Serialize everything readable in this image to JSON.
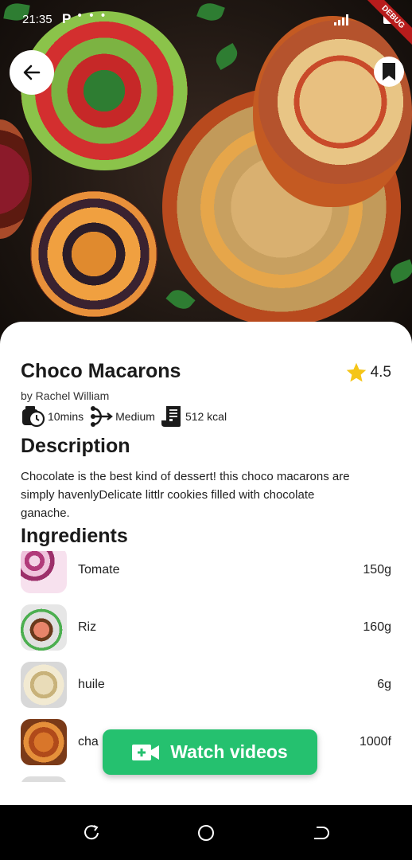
{
  "status_bar": {
    "time": "21:35",
    "notif_glyph": "P",
    "dots": "• • •",
    "debug_banner": "DEBUG"
  },
  "hero": {
    "back_icon": "arrow-left-icon",
    "bookmark_icon": "bookmark-icon"
  },
  "recipe": {
    "title": "Choco Macarons",
    "rating": "4.5",
    "author": "by Rachel William",
    "meta": [
      {
        "icon": "timer-icon",
        "label": "10mins"
      },
      {
        "icon": "difficulty-icon",
        "label": "Medium"
      },
      {
        "icon": "receipt-icon",
        "label": "512 kcal"
      }
    ]
  },
  "description": {
    "heading": "Description",
    "text": "Chocolate is the best kind of dessert! this choco macarons are simply havenlyDelicate littlr cookies filled with chocolate ganache."
  },
  "ingredients": {
    "heading": "Ingredients",
    "items": [
      {
        "name": "Tomate",
        "qty": "150g"
      },
      {
        "name": "Riz",
        "qty": "160g"
      },
      {
        "name": "huile",
        "qty": "6g"
      },
      {
        "name": "cha",
        "qty": "1000f"
      }
    ]
  },
  "actions": {
    "watch_label": "Watch videos",
    "watch_icon": "video-camera-plus-icon"
  },
  "colors": {
    "accent": "#25c16f",
    "star": "#f5c518"
  }
}
